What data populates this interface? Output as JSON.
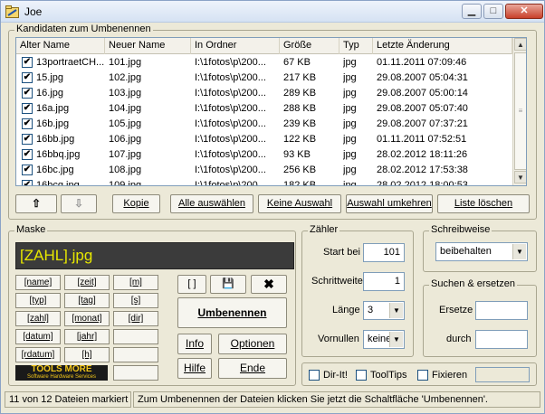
{
  "window": {
    "title": "Joe",
    "minimize": "▁",
    "maximize": "□",
    "close": "✕"
  },
  "candidates": {
    "group_label": "Kandidaten zum Umbenennen",
    "columns": [
      "Alter Name",
      "Neuer Name",
      "In Ordner",
      "Größe",
      "Typ",
      "Letzte Änderung"
    ],
    "rows": [
      {
        "checked": "✔",
        "old": "13portraetCH...",
        "new": "101.jpg",
        "folder": "I:\\1fotos\\p\\200...",
        "size": "67 KB",
        "type": "jpg",
        "modified": "01.11.2011 07:09:46"
      },
      {
        "checked": "✔",
        "old": "15.jpg",
        "new": "102.jpg",
        "folder": "I:\\1fotos\\p\\200...",
        "size": "217 KB",
        "type": "jpg",
        "modified": "29.08.2007 05:04:31"
      },
      {
        "checked": "✔",
        "old": "16.jpg",
        "new": "103.jpg",
        "folder": "I:\\1fotos\\p\\200...",
        "size": "289 KB",
        "type": "jpg",
        "modified": "29.08.2007 05:00:14"
      },
      {
        "checked": "✔",
        "old": "16a.jpg",
        "new": "104.jpg",
        "folder": "I:\\1fotos\\p\\200...",
        "size": "288 KB",
        "type": "jpg",
        "modified": "29.08.2007 05:07:40"
      },
      {
        "checked": "✔",
        "old": "16b.jpg",
        "new": "105.jpg",
        "folder": "I:\\1fotos\\p\\200...",
        "size": "239 KB",
        "type": "jpg",
        "modified": "29.08.2007 07:37:21"
      },
      {
        "checked": "✔",
        "old": "16bb.jpg",
        "new": "106.jpg",
        "folder": "I:\\1fotos\\p\\200...",
        "size": "122 KB",
        "type": "jpg",
        "modified": "01.11.2011 07:52:51"
      },
      {
        "checked": "✔",
        "old": "16bbq.jpg",
        "new": "107.jpg",
        "folder": "I:\\1fotos\\p\\200...",
        "size": "93 KB",
        "type": "jpg",
        "modified": "28.02.2012 18:11:26"
      },
      {
        "checked": "✔",
        "old": "16bc.jpg",
        "new": "108.jpg",
        "folder": "I:\\1fotos\\p\\200...",
        "size": "256 KB",
        "type": "jpg",
        "modified": "28.02.2012 17:53:38"
      },
      {
        "checked": "✔",
        "old": "16bcq.jpg",
        "new": "109.jpg",
        "folder": "I:\\1fotos\\p\\200...",
        "size": "182 KB",
        "type": "jpg",
        "modified": "28.02.2012 18:00:53"
      }
    ]
  },
  "actions": {
    "up": "⇧",
    "down": "⇩",
    "copy": "Kopie",
    "select_all": "Alle auswählen",
    "select_none": "Keine Auswahl",
    "invert": "Auswahl umkehren",
    "clear": "Liste löschen"
  },
  "mask": {
    "group_label": "Maske",
    "value": "[ZAHL].jpg",
    "tags": [
      "[name]",
      "[zeit]",
      "[m]",
      "[typ]",
      "[tag]",
      "[s]",
      "[zahl]",
      "[monat]",
      "[dir]",
      "[datum]",
      "[jahr]",
      "[rdatum]",
      "[h]"
    ],
    "logo_line1": "TOOLS MORE",
    "logo_line2": "Software Hardware Services",
    "bracket_btn": "[ ]",
    "save_icon": "💾",
    "delete_icon": "✖",
    "rename": "Umbenennen",
    "info": "Info",
    "options": "Optionen",
    "help": "Hilfe",
    "quit": "Ende"
  },
  "counter": {
    "group_label": "Zähler",
    "start_label": "Start bei",
    "start_value": "101",
    "step_label": "Schrittweite",
    "step_value": "1",
    "length_label": "Länge",
    "length_value": "3",
    "zeros_label": "Vornullen",
    "zeros_value": "keine"
  },
  "case": {
    "group_label": "Schreibweise",
    "value": "beibehalten"
  },
  "search": {
    "group_label": "Suchen & ersetzen",
    "replace_label": "Ersetze",
    "replace_value": "",
    "with_label": "durch",
    "with_value": ""
  },
  "checks": {
    "dirit": "Dir-It!",
    "tooltips": "ToolTips",
    "fixed": "Fixieren"
  },
  "status": {
    "count": "11 von 12 Dateien markiert",
    "message": "Zum Umbenennen der Dateien klicken Sie jetzt die Schaltfläche 'Umbenennen'."
  }
}
